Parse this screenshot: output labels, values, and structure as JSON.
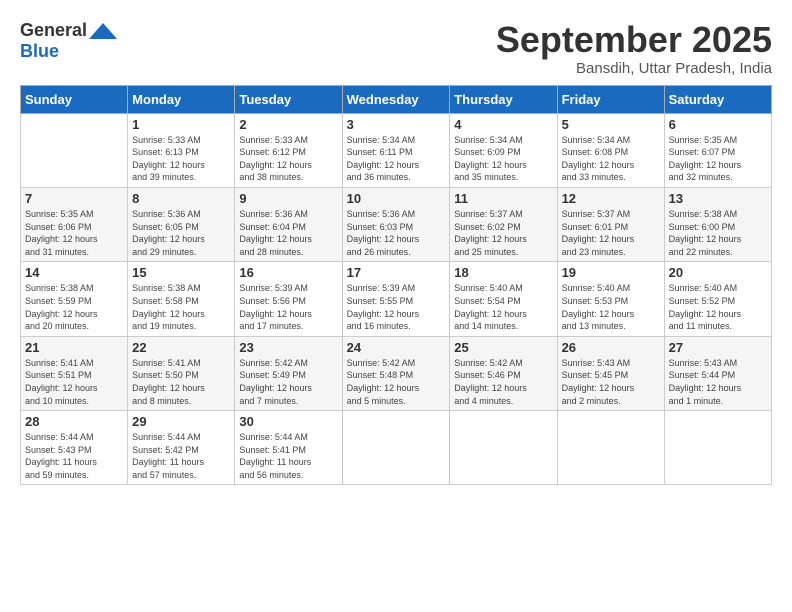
{
  "logo": {
    "general": "General",
    "blue": "Blue"
  },
  "header": {
    "month": "September 2025",
    "location": "Bansdih, Uttar Pradesh, India"
  },
  "weekdays": [
    "Sunday",
    "Monday",
    "Tuesday",
    "Wednesday",
    "Thursday",
    "Friday",
    "Saturday"
  ],
  "weeks": [
    [
      {
        "day": "",
        "info": ""
      },
      {
        "day": "1",
        "info": "Sunrise: 5:33 AM\nSunset: 6:13 PM\nDaylight: 12 hours\nand 39 minutes."
      },
      {
        "day": "2",
        "info": "Sunrise: 5:33 AM\nSunset: 6:12 PM\nDaylight: 12 hours\nand 38 minutes."
      },
      {
        "day": "3",
        "info": "Sunrise: 5:34 AM\nSunset: 6:11 PM\nDaylight: 12 hours\nand 36 minutes."
      },
      {
        "day": "4",
        "info": "Sunrise: 5:34 AM\nSunset: 6:09 PM\nDaylight: 12 hours\nand 35 minutes."
      },
      {
        "day": "5",
        "info": "Sunrise: 5:34 AM\nSunset: 6:08 PM\nDaylight: 12 hours\nand 33 minutes."
      },
      {
        "day": "6",
        "info": "Sunrise: 5:35 AM\nSunset: 6:07 PM\nDaylight: 12 hours\nand 32 minutes."
      }
    ],
    [
      {
        "day": "7",
        "info": "Sunrise: 5:35 AM\nSunset: 6:06 PM\nDaylight: 12 hours\nand 31 minutes."
      },
      {
        "day": "8",
        "info": "Sunrise: 5:36 AM\nSunset: 6:05 PM\nDaylight: 12 hours\nand 29 minutes."
      },
      {
        "day": "9",
        "info": "Sunrise: 5:36 AM\nSunset: 6:04 PM\nDaylight: 12 hours\nand 28 minutes."
      },
      {
        "day": "10",
        "info": "Sunrise: 5:36 AM\nSunset: 6:03 PM\nDaylight: 12 hours\nand 26 minutes."
      },
      {
        "day": "11",
        "info": "Sunrise: 5:37 AM\nSunset: 6:02 PM\nDaylight: 12 hours\nand 25 minutes."
      },
      {
        "day": "12",
        "info": "Sunrise: 5:37 AM\nSunset: 6:01 PM\nDaylight: 12 hours\nand 23 minutes."
      },
      {
        "day": "13",
        "info": "Sunrise: 5:38 AM\nSunset: 6:00 PM\nDaylight: 12 hours\nand 22 minutes."
      }
    ],
    [
      {
        "day": "14",
        "info": "Sunrise: 5:38 AM\nSunset: 5:59 PM\nDaylight: 12 hours\nand 20 minutes."
      },
      {
        "day": "15",
        "info": "Sunrise: 5:38 AM\nSunset: 5:58 PM\nDaylight: 12 hours\nand 19 minutes."
      },
      {
        "day": "16",
        "info": "Sunrise: 5:39 AM\nSunset: 5:56 PM\nDaylight: 12 hours\nand 17 minutes."
      },
      {
        "day": "17",
        "info": "Sunrise: 5:39 AM\nSunset: 5:55 PM\nDaylight: 12 hours\nand 16 minutes."
      },
      {
        "day": "18",
        "info": "Sunrise: 5:40 AM\nSunset: 5:54 PM\nDaylight: 12 hours\nand 14 minutes."
      },
      {
        "day": "19",
        "info": "Sunrise: 5:40 AM\nSunset: 5:53 PM\nDaylight: 12 hours\nand 13 minutes."
      },
      {
        "day": "20",
        "info": "Sunrise: 5:40 AM\nSunset: 5:52 PM\nDaylight: 12 hours\nand 11 minutes."
      }
    ],
    [
      {
        "day": "21",
        "info": "Sunrise: 5:41 AM\nSunset: 5:51 PM\nDaylight: 12 hours\nand 10 minutes."
      },
      {
        "day": "22",
        "info": "Sunrise: 5:41 AM\nSunset: 5:50 PM\nDaylight: 12 hours\nand 8 minutes."
      },
      {
        "day": "23",
        "info": "Sunrise: 5:42 AM\nSunset: 5:49 PM\nDaylight: 12 hours\nand 7 minutes."
      },
      {
        "day": "24",
        "info": "Sunrise: 5:42 AM\nSunset: 5:48 PM\nDaylight: 12 hours\nand 5 minutes."
      },
      {
        "day": "25",
        "info": "Sunrise: 5:42 AM\nSunset: 5:46 PM\nDaylight: 12 hours\nand 4 minutes."
      },
      {
        "day": "26",
        "info": "Sunrise: 5:43 AM\nSunset: 5:45 PM\nDaylight: 12 hours\nand 2 minutes."
      },
      {
        "day": "27",
        "info": "Sunrise: 5:43 AM\nSunset: 5:44 PM\nDaylight: 12 hours\nand 1 minute."
      }
    ],
    [
      {
        "day": "28",
        "info": "Sunrise: 5:44 AM\nSunset: 5:43 PM\nDaylight: 11 hours\nand 59 minutes."
      },
      {
        "day": "29",
        "info": "Sunrise: 5:44 AM\nSunset: 5:42 PM\nDaylight: 11 hours\nand 57 minutes."
      },
      {
        "day": "30",
        "info": "Sunrise: 5:44 AM\nSunset: 5:41 PM\nDaylight: 11 hours\nand 56 minutes."
      },
      {
        "day": "",
        "info": ""
      },
      {
        "day": "",
        "info": ""
      },
      {
        "day": "",
        "info": ""
      },
      {
        "day": "",
        "info": ""
      }
    ]
  ]
}
